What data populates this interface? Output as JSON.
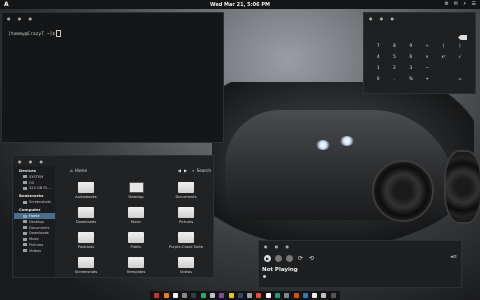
{
  "top_panel": {
    "logo": "A",
    "clock": "Wed Mar 21,  5:06 PM",
    "tray": [
      "⚙",
      "✉",
      "⚡",
      "☰"
    ]
  },
  "terminal": {
    "prompt": "[tommy@CrazyT ~]$"
  },
  "calculator": {
    "keys": [
      "7",
      "8",
      "9",
      "÷",
      "(",
      ")",
      "4",
      "5",
      "6",
      "×",
      "x²",
      "√",
      "1",
      "2",
      "3",
      "−",
      "",
      "",
      "0",
      ".",
      "%",
      "+",
      "",
      "="
    ]
  },
  "files": {
    "location": "Home",
    "search_label": "Search",
    "sidebar": {
      "devices_header": "Devices",
      "devices": [
        "SYSTEM",
        "OS",
        "320 GB Fil..."
      ],
      "bookmarks_header": "Bookmarks",
      "bookmarks": [
        "Screenshots"
      ],
      "computer_header": "Computer",
      "computer": [
        "Home",
        "Desktop",
        "Documents",
        "Downloads",
        "Music",
        "Pictures",
        "Videos"
      ]
    },
    "items": [
      "Audiobooks",
      "Desktop",
      "Documents",
      "Downloads",
      "Music",
      "Pictures",
      "Podcasts",
      "Public",
      "Purple-Craze Suite",
      "Screenshots",
      "Templates",
      "Videos"
    ]
  },
  "music": {
    "status": "Not Playing"
  },
  "dock": {
    "apps": [
      "#c0392b",
      "#e67e22",
      "#f5f5f5",
      "#888888",
      "#2c3e50",
      "#27ae60",
      "#bdc3c7",
      "#8e44ad",
      "#f1c40f",
      "#34495e",
      "#95a5a6",
      "#e74c3c",
      "#ffffff",
      "#16a085",
      "#7f8c8d",
      "#d35400",
      "#2980b9",
      "#ecf0f1",
      "#c0c0c0",
      "#555555"
    ]
  }
}
